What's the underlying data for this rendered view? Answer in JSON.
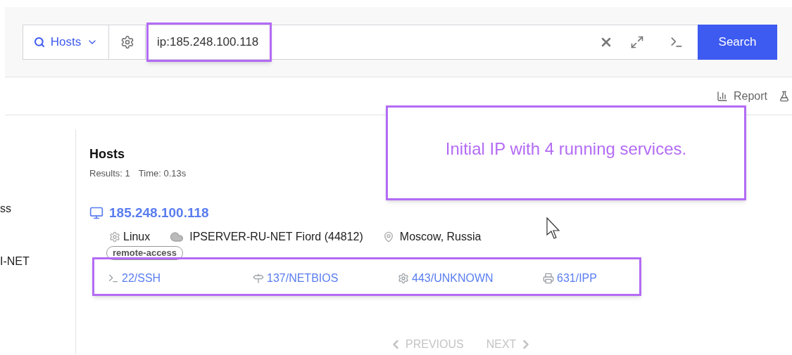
{
  "search_bar": {
    "scope": "Hosts",
    "query": "ip:185.248.100.118",
    "button": "Search"
  },
  "toolbar": {
    "report": "Report"
  },
  "sidebar": {
    "items": [
      "ss",
      "I-NET"
    ]
  },
  "results": {
    "title": "Hosts",
    "count": "Results: 1",
    "time": "Time: 0.13s",
    "hosts": [
      {
        "ip": "185.248.100.118",
        "os": "Linux",
        "network": "IPSERVER-RU-NET Fiord (44812)",
        "location": "Moscow, Russia",
        "tags": [
          "remote-access"
        ],
        "services": [
          {
            "kind": "terminal",
            "label": "22/SSH"
          },
          {
            "kind": "signpost",
            "label": "137/NETBIOS"
          },
          {
            "kind": "gear",
            "label": "443/UNKNOWN"
          },
          {
            "kind": "printer",
            "label": "631/IPP"
          }
        ]
      }
    ]
  },
  "pagination": {
    "previous": {
      "label": "PREVIOUS",
      "disabled": true
    },
    "next": {
      "label": "NEXT",
      "disabled": true
    }
  },
  "annotation": {
    "text": "Initial IP with 4 running services."
  }
}
